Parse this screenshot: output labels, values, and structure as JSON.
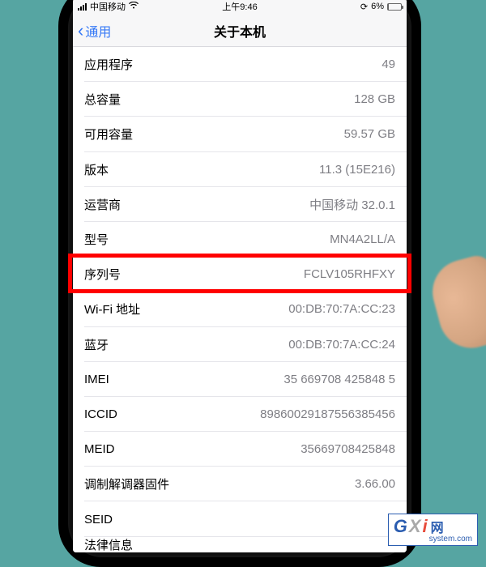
{
  "status": {
    "carrier": "中国移动",
    "time": "上午9:46",
    "battery": "6%"
  },
  "nav": {
    "back": "通用",
    "title": "关于本机"
  },
  "rows": [
    {
      "label": "应用程序",
      "value": "49"
    },
    {
      "label": "总容量",
      "value": "128 GB"
    },
    {
      "label": "可用容量",
      "value": "59.57 GB"
    },
    {
      "label": "版本",
      "value": "11.3 (15E216)"
    },
    {
      "label": "运营商",
      "value": "中国移动 32.0.1"
    },
    {
      "label": "型号",
      "value": "MN4A2LL/A"
    },
    {
      "label": "序列号",
      "value": "FCLV105RHFXY"
    },
    {
      "label": "Wi-Fi 地址",
      "value": "00:DB:70:7A:CC:23"
    },
    {
      "label": "蓝牙",
      "value": "00:DB:70:7A:CC:24"
    },
    {
      "label": "IMEI",
      "value": "35 669708 425848 5"
    },
    {
      "label": "ICCID",
      "value": "89860029187556385456"
    },
    {
      "label": "MEID",
      "value": "35669708425848"
    },
    {
      "label": "调制解调器固件",
      "value": "3.66.00"
    },
    {
      "label": "SEID",
      "value": "",
      "disclosure": true
    }
  ],
  "truncated_row_label": "法律信息",
  "highlighted_row_index": 6,
  "watermark": {
    "brand_cn": "网",
    "url": "system.com"
  }
}
